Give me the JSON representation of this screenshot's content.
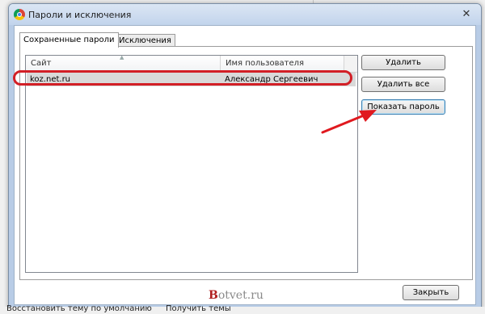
{
  "window": {
    "title": "Пароли и исключения",
    "close_glyph": "✕"
  },
  "tabs": [
    {
      "label": "Сохраненные пароли"
    },
    {
      "label": "Исключения"
    }
  ],
  "table": {
    "columns": [
      "Сайт",
      "Имя пользователя"
    ],
    "rows": [
      {
        "site": "koz.net.ru",
        "username": "Александр Сергеевич"
      }
    ]
  },
  "buttons": {
    "delete": "Удалить",
    "delete_all": "Удалить все",
    "show_password": "Показать пароль",
    "close": "Закрыть"
  },
  "watermark": {
    "first": "B",
    "rest": "otvet.ru"
  },
  "background": {
    "restore_theme": "Восстановить тему по умолчанию",
    "get_themes": "Получить темы"
  },
  "annotation": {
    "highlight_color": "#d21f26",
    "arrow_color": "#e0191f"
  }
}
